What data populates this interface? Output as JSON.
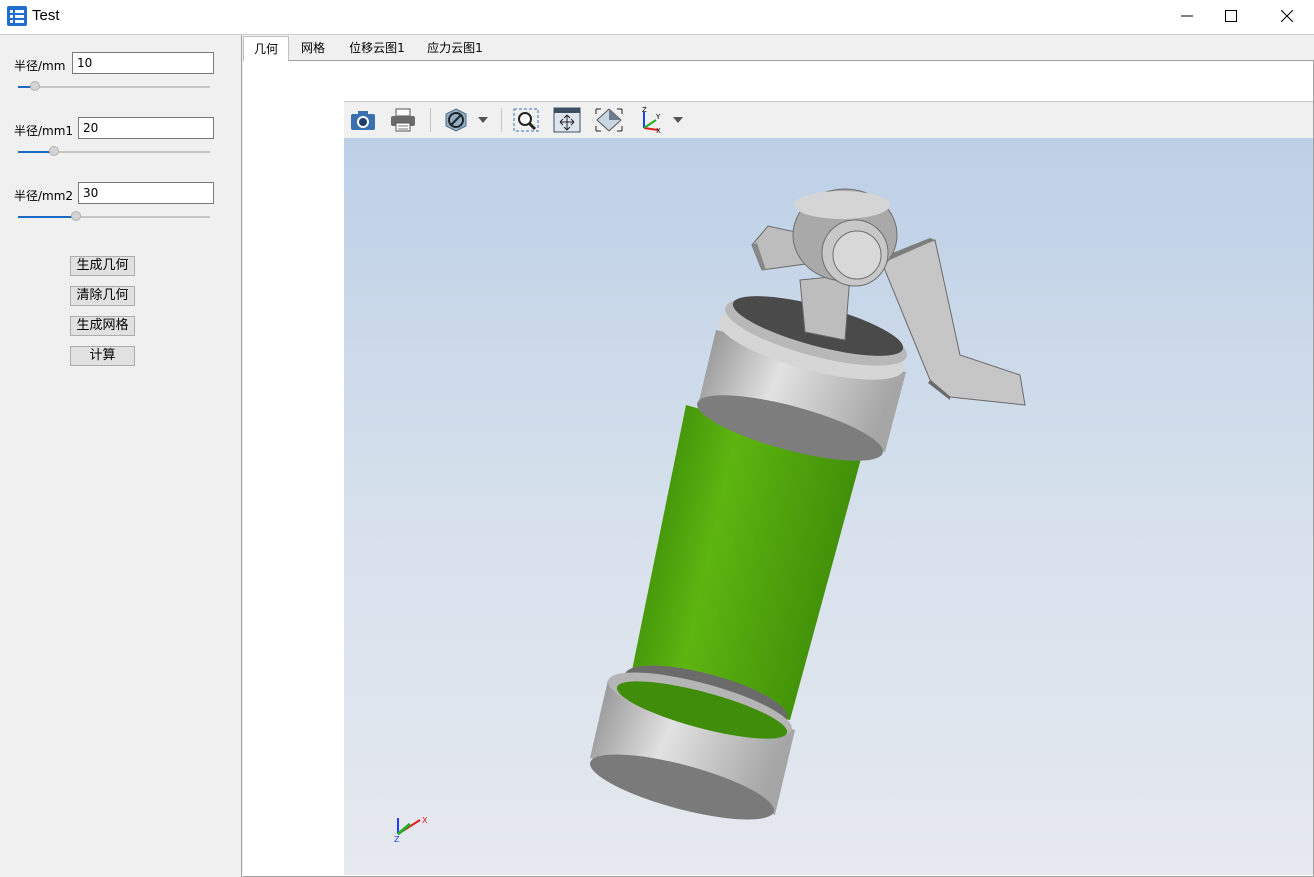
{
  "window": {
    "title": "Test"
  },
  "params": [
    {
      "label": "半径/mm",
      "value": "10",
      "slider_fraction": 0.09
    },
    {
      "label": "半径/mm1",
      "value": "20",
      "slider_fraction": 0.19
    },
    {
      "label": "半径/mm2",
      "value": "30",
      "slider_fraction": 0.3
    }
  ],
  "buttons": {
    "generate_geometry": "生成几何",
    "clear_geometry": "清除几何",
    "generate_mesh": "生成网格",
    "compute": "计算"
  },
  "tabs": [
    {
      "label": "几何",
      "active": true
    },
    {
      "label": "网格",
      "active": false
    },
    {
      "label": "位移云图1",
      "active": false
    },
    {
      "label": "应力云图1",
      "active": false
    }
  ],
  "toolbar": {
    "icons": [
      "camera-icon",
      "print-icon",
      "hide-icon",
      "zoom-area-icon",
      "fit-all-icon",
      "pan-icon",
      "axes-icon"
    ]
  },
  "triad_labels": {
    "x": "X",
    "y": "Y",
    "z": "Z"
  },
  "colors": {
    "body_green": "#5aae0c",
    "metal_gray": "#c8c8c8",
    "accent_blue": "#1b6bc5"
  }
}
